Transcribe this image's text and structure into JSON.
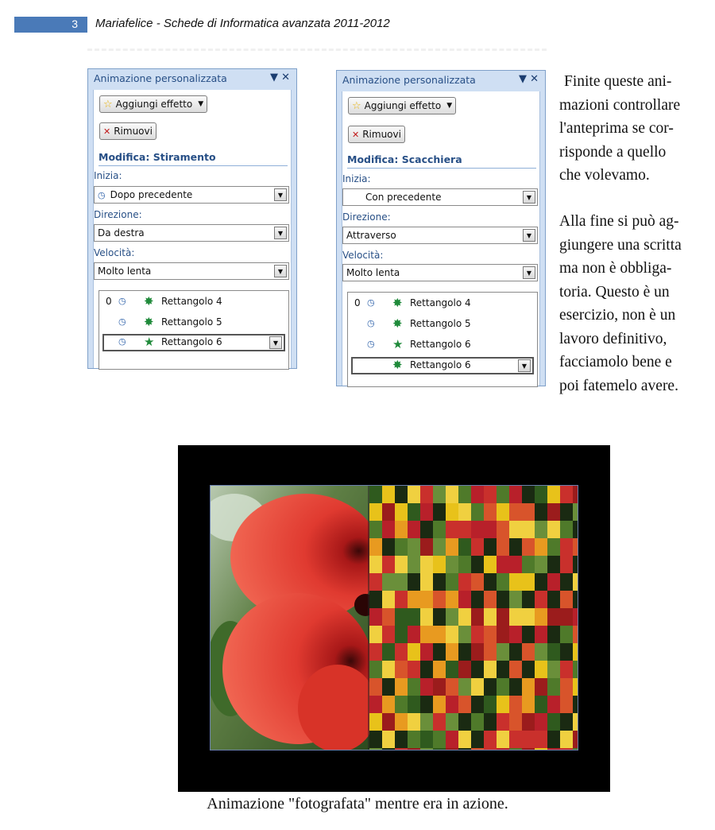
{
  "header": {
    "page_number": "3",
    "title": "Mariafelice - Schede di Informatica avanzata 2011-2012"
  },
  "pane_left": {
    "title": "Animazione personalizzata",
    "add_effect_label": "Aggiungi effetto",
    "remove_label": "Rimuovi",
    "modify_label": "Modifica: Stiramento",
    "start_label": "Inizia:",
    "start_value": "Dopo precedente",
    "direction_label": "Direzione:",
    "direction_value": "Da destra",
    "speed_label": "Velocità:",
    "speed_value": "Molto lenta",
    "items": [
      {
        "index": "0",
        "label": "Rettangolo 4"
      },
      {
        "index": "",
        "label": "Rettangolo 5"
      },
      {
        "index": "",
        "label": "Rettangolo 6"
      }
    ]
  },
  "pane_right": {
    "title": "Animazione personalizzata",
    "add_effect_label": "Aggiungi effetto",
    "remove_label": "Rimuovi",
    "modify_label": "Modifica: Scacchiera",
    "start_label": "Inizia:",
    "start_value": "Con precedente",
    "direction_label": "Direzione:",
    "direction_value": "Attraverso",
    "speed_label": "Velocità:",
    "speed_value": "Molto lenta",
    "items": [
      {
        "index": "0",
        "label": "Rettangolo 4"
      },
      {
        "index": "",
        "label": "Rettangolo 5"
      },
      {
        "index": "",
        "label": "Rettangolo 6"
      },
      {
        "index": "",
        "label": "Rettangolo 6"
      }
    ]
  },
  "text": {
    "para1": [
      "Finite queste ani-",
      "mazioni controllare",
      "l'anteprima se cor-",
      "risponde a quello",
      "che volevamo."
    ],
    "para2": [
      "Alla fine si può ag-",
      "giungere una scritta",
      "ma non è obbliga-",
      "toria. Questo è un",
      "esercizio, non è un",
      "lavoro definitivo,",
      "facciamolo bene e",
      "poi fatemelo avere."
    ]
  },
  "caption": "Animazione \"fotografata\" mentre era in azione."
}
